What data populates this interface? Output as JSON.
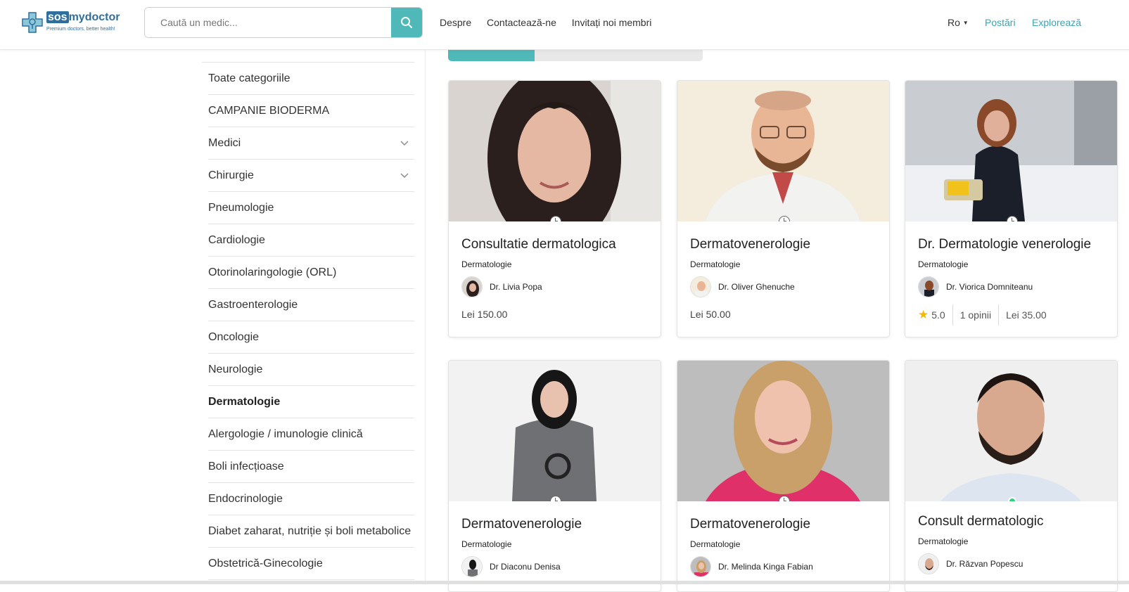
{
  "brand": {
    "name_sos": "sos",
    "name_rest": "mydoctor",
    "tagline": "Premium doctors, better health!",
    "color": "#2e6f9e"
  },
  "search": {
    "placeholder": "Caută un medic..."
  },
  "nav": {
    "about": "Despre",
    "contact": "Contactează-ne",
    "invite": "Invitați noi membri"
  },
  "language": {
    "value": "Ro"
  },
  "right_links": {
    "posts": "Postări",
    "explore": "Explorează"
  },
  "accent_color": "#4fb8b8",
  "categories": [
    {
      "label": "Toate categoriile",
      "expandable": false,
      "active": false
    },
    {
      "label": "CAMPANIE BIODERMA",
      "expandable": false,
      "active": false
    },
    {
      "label": "Medici",
      "expandable": true,
      "active": false
    },
    {
      "label": "Chirurgie",
      "expandable": true,
      "active": false
    },
    {
      "label": "Pneumologie",
      "expandable": false,
      "active": false
    },
    {
      "label": "Cardiologie",
      "expandable": false,
      "active": false
    },
    {
      "label": "Otorinolaringologie (ORL)",
      "expandable": false,
      "active": false
    },
    {
      "label": "Gastroenterologie",
      "expandable": false,
      "active": false
    },
    {
      "label": "Oncologie",
      "expandable": false,
      "active": false
    },
    {
      "label": "Neurologie",
      "expandable": false,
      "active": false
    },
    {
      "label": "Dermatologie",
      "expandable": false,
      "active": true
    },
    {
      "label": "Alergologie / imunologie clinică",
      "expandable": false,
      "active": false
    },
    {
      "label": "Boli infecțioase",
      "expandable": false,
      "active": false
    },
    {
      "label": "Endocrinologie",
      "expandable": false,
      "active": false
    },
    {
      "label": "Diabet zaharat, nutriție și boli metabolice",
      "expandable": false,
      "active": false
    },
    {
      "label": "Obstetrică-Ginecologie",
      "expandable": false,
      "active": false
    }
  ],
  "cards": [
    {
      "title": "Consultatie dermatologica",
      "category": "Dermatologie",
      "doctor": "Dr. Livia Popa",
      "price": "Lei 150.00",
      "status_icon": "clock-icon"
    },
    {
      "title": "Dermatovenerologie",
      "category": "Dermatologie",
      "doctor": "Dr. Oliver Ghenuche",
      "price": "Lei 50.00",
      "status_icon": "clock-icon"
    },
    {
      "title": "Dr. Dermatologie venerologie",
      "category": "Dermatologie",
      "doctor": "Dr. Viorica Domniteanu",
      "rating": "5.0",
      "reviews": "1 opinii",
      "price": "Lei 35.00",
      "status_icon": "clock-icon"
    },
    {
      "title": "Dermatovenerologie",
      "category": "Dermatologie",
      "doctor": "Dr Diaconu Denisa",
      "status_icon": "clock-icon"
    },
    {
      "title": "Dermatovenerologie",
      "category": "Dermatologie",
      "doctor": "Dr. Melinda Kinga Fabian",
      "status_icon": "clock-icon"
    },
    {
      "title": "Consult dermatologic",
      "category": "Dermatologie",
      "doctor": "Dr. Răzvan Popescu",
      "status_icon": "online-dot-icon"
    }
  ]
}
